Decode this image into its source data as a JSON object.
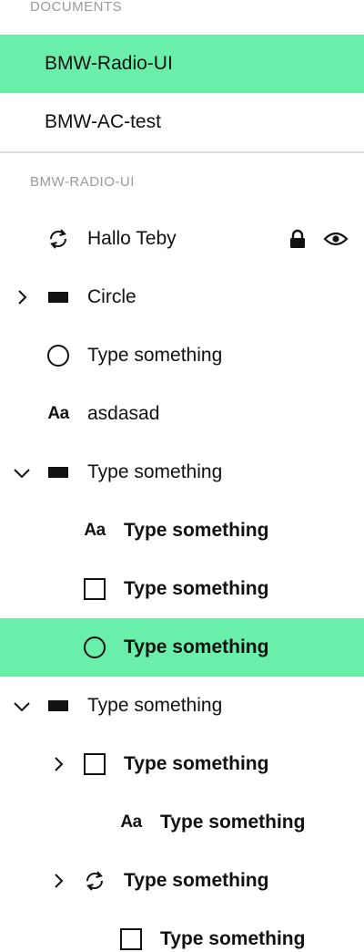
{
  "documents": {
    "header": "DOCUMENTS",
    "items": [
      {
        "label": "BMW-Radio-UI",
        "selected": true
      },
      {
        "label": "BMW-AC-test",
        "selected": false
      }
    ]
  },
  "layers": {
    "header": "BMW-RADIO-UI",
    "items": [
      {
        "label": "Hallo Teby",
        "icon": "rotate-icon",
        "chevron": "none",
        "depth": 0,
        "bold": false,
        "selected": false,
        "locked": true,
        "visible": true
      },
      {
        "label": "Circle",
        "icon": "rectangle-filled-icon",
        "chevron": "collapsed",
        "depth": 0,
        "bold": false,
        "selected": false
      },
      {
        "label": "Type something",
        "icon": "circle-icon",
        "chevron": "none",
        "depth": 0,
        "bold": false,
        "selected": false
      },
      {
        "label": "asdasad",
        "icon": "text-icon",
        "icon_text": "Aa",
        "chevron": "none",
        "depth": 0,
        "bold": false,
        "selected": false
      },
      {
        "label": "Type something",
        "icon": "rectangle-filled-icon",
        "chevron": "expanded",
        "depth": 0,
        "bold": false,
        "selected": false
      },
      {
        "label": "Type something",
        "icon": "text-icon",
        "icon_text": "Aa",
        "chevron": "none",
        "depth": 1,
        "bold": true,
        "selected": false
      },
      {
        "label": "Type something",
        "icon": "square-icon",
        "chevron": "none",
        "depth": 1,
        "bold": true,
        "selected": false
      },
      {
        "label": "Type something",
        "icon": "circle-icon",
        "chevron": "none",
        "depth": 1,
        "bold": true,
        "selected": true
      },
      {
        "label": "Type something",
        "icon": "rectangle-filled-icon",
        "chevron": "expanded",
        "depth": 0,
        "bold": false,
        "selected": false
      },
      {
        "label": "Type something",
        "icon": "square-icon",
        "chevron": "collapsed",
        "depth": 1,
        "bold": true,
        "selected": false
      },
      {
        "label": "Type something",
        "icon": "text-icon",
        "icon_text": "Aa",
        "chevron": "none",
        "depth": 2,
        "bold": true,
        "selected": false
      },
      {
        "label": "Type something",
        "icon": "rotate-icon",
        "chevron": "collapsed",
        "depth": 1,
        "bold": true,
        "selected": false
      },
      {
        "label": "Type something",
        "icon": "square-icon",
        "chevron": "none",
        "depth": 2,
        "bold": true,
        "selected": false
      }
    ]
  },
  "colors": {
    "selected_bg": "#69efaa",
    "header_text": "#9a9a9a",
    "divider": "#dcdcdc"
  }
}
